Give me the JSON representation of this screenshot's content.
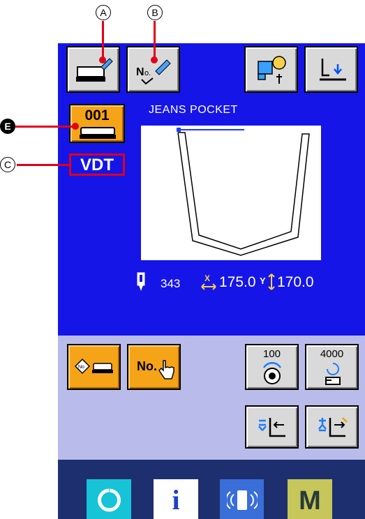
{
  "callouts": {
    "a": "A",
    "b": "B",
    "c": "C",
    "e": "E"
  },
  "pattern": {
    "number": "001",
    "name": "JEANS POCKET",
    "mode_label": "VDT"
  },
  "readouts": {
    "stitch_count": "343",
    "x_size": "175.0",
    "y_size": "170.0"
  },
  "counters": {
    "bobbin_value": "100",
    "production_value": "4000"
  },
  "buttons": {
    "no_button_label": "No."
  },
  "nav": {
    "info_label": "i",
    "menu_label": "M"
  },
  "colors": {
    "panel_blue": "#1515e8",
    "orange": "#f5a418",
    "lower_panel": "#b9bcea",
    "nav_dark": "#1d2f6e",
    "callout_red": "#e0001b"
  }
}
